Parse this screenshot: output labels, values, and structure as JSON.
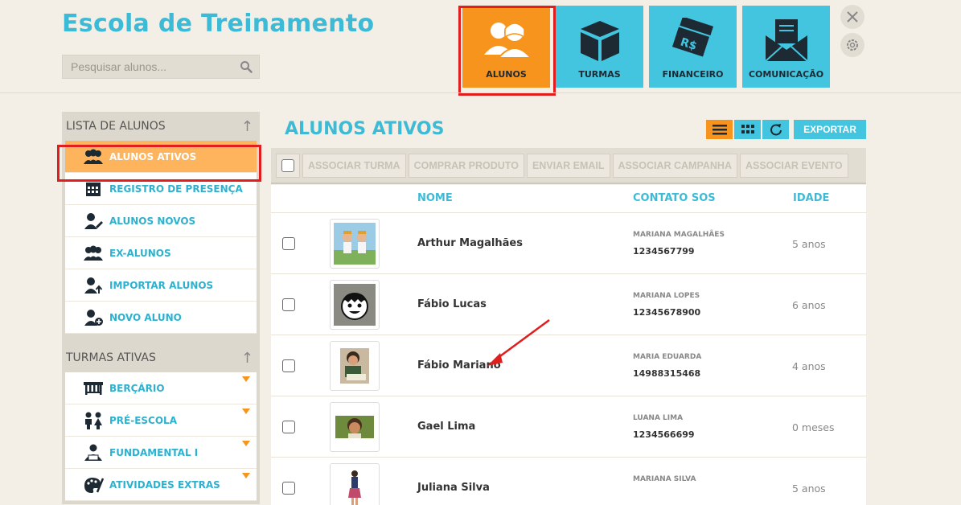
{
  "header": {
    "app_title": "Escola de Treinamento",
    "search_placeholder": "Pesquisar alunos..."
  },
  "modules": [
    {
      "label": "ALUNOS",
      "icon": "students-icon",
      "active": true
    },
    {
      "label": "TURMAS",
      "icon": "box-icon",
      "active": false
    },
    {
      "label": "FINANCEIRO",
      "icon": "money-icon",
      "active": false
    },
    {
      "label": "COMUNICAÇÃO",
      "icon": "mail-icon",
      "active": false
    }
  ],
  "sidebar": {
    "list_title": "LISTA DE ALUNOS",
    "list_items": [
      {
        "label": "ALUNOS ATIVOS",
        "icon": "group-icon",
        "active": true
      },
      {
        "label": "REGISTRO DE PRESENÇA",
        "icon": "calendar-icon"
      },
      {
        "label": "ALUNOS NOVOS",
        "icon": "user-edit-icon"
      },
      {
        "label": "EX-ALUNOS",
        "icon": "group-icon"
      },
      {
        "label": "IMPORTAR ALUNOS",
        "icon": "user-import-icon"
      },
      {
        "label": "NOVO ALUNO",
        "icon": "user-add-icon"
      }
    ],
    "classes_title": "TURMAS ATIVAS",
    "class_items": [
      {
        "label": "BERÇÁRIO",
        "icon": "crib-icon"
      },
      {
        "label": "PRÉ-ESCOLA",
        "icon": "kids-icon"
      },
      {
        "label": "FUNDAMENTAL I",
        "icon": "student-reading-icon"
      },
      {
        "label": "ATIVIDADES EXTRAS",
        "icon": "palette-icon"
      }
    ]
  },
  "main": {
    "title": "ALUNOS ATIVOS",
    "export_label": "EXPORTAR",
    "toolbar": [
      "ASSOCIAR TURMA",
      "COMPRAR PRODUTO",
      "ENVIAR EMAIL",
      "ASSOCIAR CAMPANHA",
      "ASSOCIAR EVENTO"
    ],
    "columns": {
      "name": "NOME",
      "contact": "CONTATO SOS",
      "age": "IDADE"
    },
    "rows": [
      {
        "name": "Arthur Magalhães",
        "contact_name": "MARIANA MAGALHÃES",
        "contact_phone": "1234567799",
        "age": "5 anos"
      },
      {
        "name": "Fábio Lucas",
        "contact_name": "MARIANA LOPES",
        "contact_phone": "12345678900",
        "age": "6 anos"
      },
      {
        "name": "Fábio Mariano",
        "contact_name": "MARIA EDUARDA",
        "contact_phone": "14988315468",
        "age": "4 anos"
      },
      {
        "name": "Gael Lima",
        "contact_name": "LUANA LIMA",
        "contact_phone": "1234566699",
        "age": "0 meses"
      },
      {
        "name": "Juliana Silva",
        "contact_name": "MARIANA SILVA",
        "contact_phone": "",
        "age": "5 anos"
      }
    ]
  },
  "colors": {
    "accent": "#43c5e0",
    "active": "#f7941d",
    "highlight": "#e01e1e"
  }
}
